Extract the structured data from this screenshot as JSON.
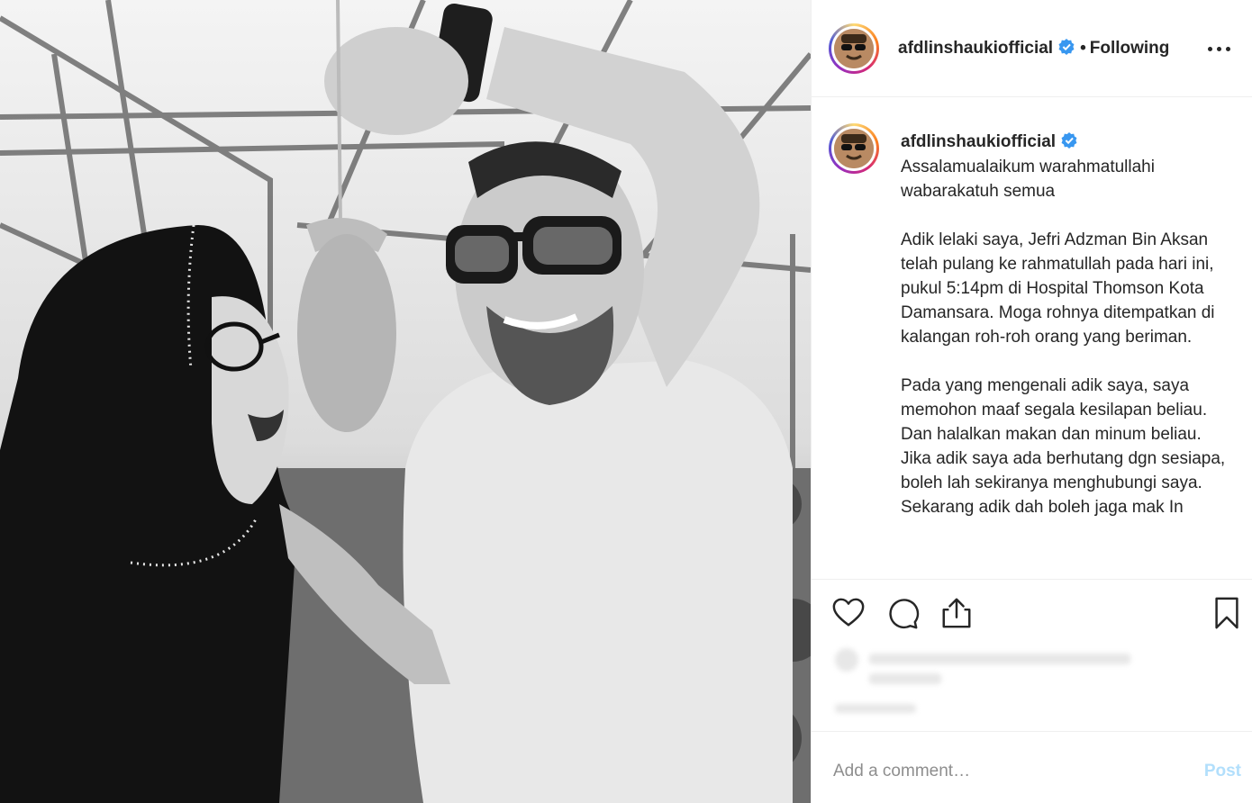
{
  "post": {
    "username": "afdlinshaukiofficial",
    "separator": "•",
    "follow_status": "Following"
  },
  "caption": {
    "username": "afdlinshaukiofficial",
    "paragraphs": [
      "Assalamualaikum warahmatullahi wabarakatuh semua",
      "Adik lelaki saya, Jefri Adzman Bin Aksan telah pulang ke rahmatullah pada hari ini, pukul 5:14pm di Hospital Thomson Kota Damansara. Moga rohnya ditempatkan di kalangan roh-roh orang yang beriman.",
      "Pada yang mengenali adik saya, saya memohon maaf segala kesilapan beliau. Dan halalkan makan dan minum beliau. Jika adik saya ada berhutang dgn sesiapa, boleh lah sekiranya menghubungi saya. Sekarang adik dah boleh jaga mak In"
    ]
  },
  "actions": {
    "like_icon": "heart-outline-icon",
    "comment_icon": "speech-bubble-icon",
    "share_icon": "share-upload-icon",
    "save_icon": "bookmark-outline-icon"
  },
  "comment": {
    "placeholder": "Add a comment…",
    "post_label": "Post"
  },
  "colors": {
    "verified": "#3897f0",
    "post_disabled": "#b2dffc",
    "border": "#efefef"
  }
}
